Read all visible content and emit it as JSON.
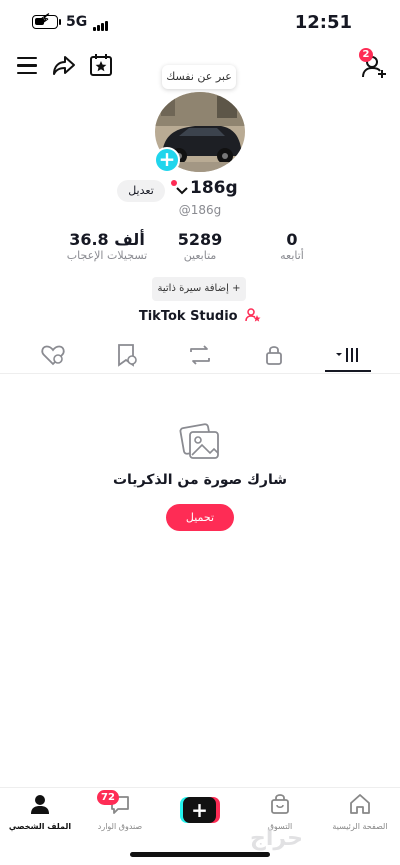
{
  "status_bar": {
    "network": "5G",
    "time": "12:51"
  },
  "header": {
    "add_friend_badge": "2"
  },
  "profile": {
    "bubble_text": "عبر عن نفسك",
    "edit_label": "تعديل",
    "username": "186g",
    "handle": "@186g",
    "stats": [
      {
        "value": "36.8 ألف",
        "label": "تسجيلات الإعجاب"
      },
      {
        "value": "5289",
        "label": "متابعين"
      },
      {
        "value": "0",
        "label": "أتابعه"
      }
    ],
    "add_bio_label": "إضافة سيرة ذاتية",
    "studio_label": "TikTok Studio"
  },
  "empty_state": {
    "title": "شارك صورة من الذكريات",
    "upload_label": "تحميل"
  },
  "bottom_nav": {
    "items": [
      {
        "label": "الصفحة الرئيسية"
      },
      {
        "label": "التسوق"
      },
      {
        "label": ""
      },
      {
        "label": "صندوق الوارد",
        "badge": "72"
      },
      {
        "label": "الملف الشخصي"
      }
    ]
  },
  "watermark": "حراج",
  "colors": {
    "accent": "#fe2c55",
    "avatar_plus": "#20d5ec",
    "muted_text": "#8a8b91"
  }
}
